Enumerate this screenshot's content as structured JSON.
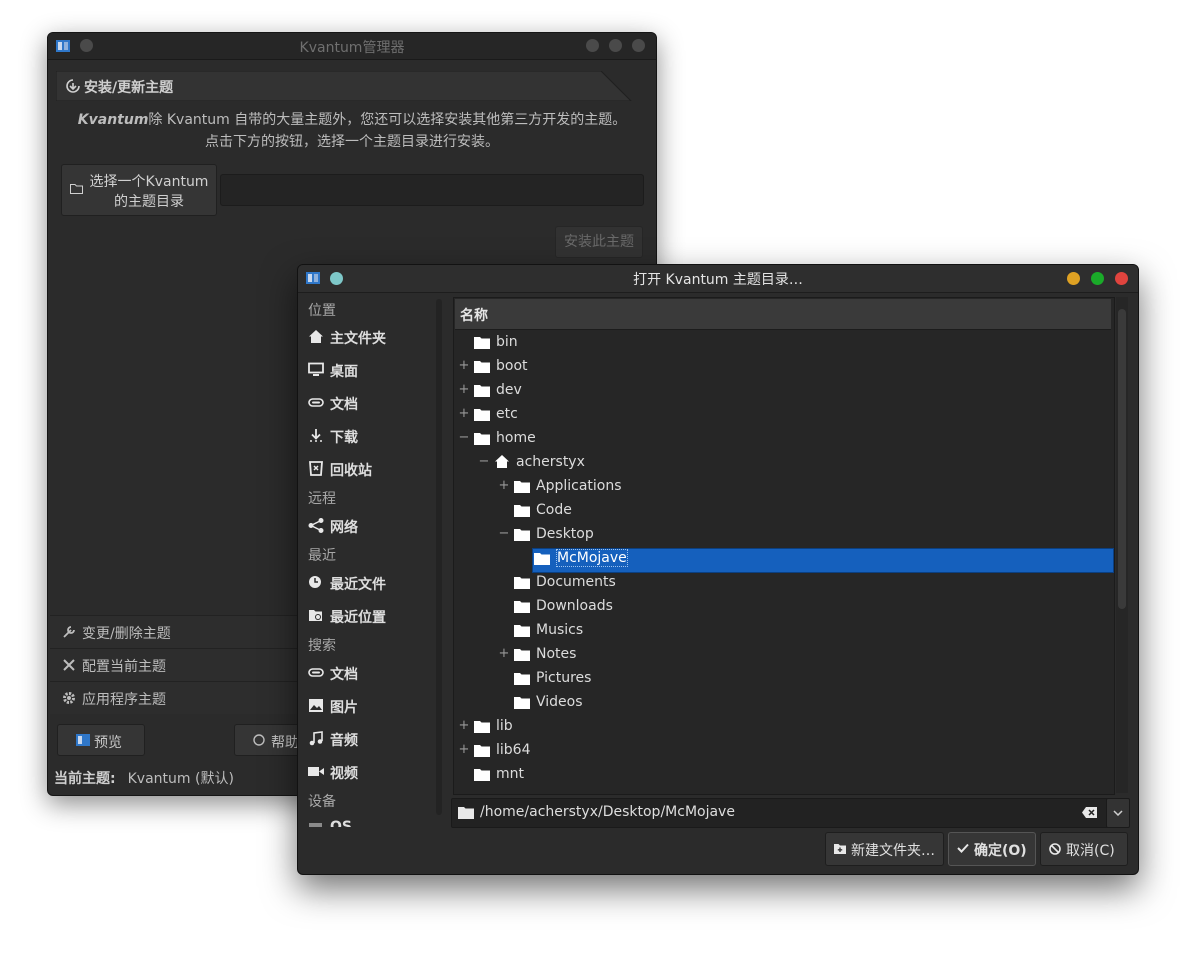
{
  "manager": {
    "title": "Kvantum管理器",
    "tab_label": "安装/更新主题",
    "description_brand": "Kvantum",
    "description_line1": "除 Kvantum 自带的大量主题外，您还可以选择安装其他第三方开发的主题。",
    "description_line2": "点击下方的按钮，选择一个主题目录进行安装。",
    "select_button_line1": "选择一个Kvantum",
    "select_button_line2": "的主题目录",
    "install_button": "安装此主题",
    "sections": [
      "变更/删除主题",
      "配置当前主题",
      "应用程序主题"
    ],
    "preview_button": "预览",
    "help_button": "帮助",
    "status_label": "当前主题:",
    "status_value": "Kvantum (默认)"
  },
  "dialog": {
    "title": "打开 Kvantum 主题目录…",
    "sidebar": {
      "places_header": "位置",
      "places": [
        {
          "label": "主文件夹",
          "icon": "home-icon"
        },
        {
          "label": "桌面",
          "icon": "desktop-icon"
        },
        {
          "label": "文档",
          "icon": "documents-icon"
        },
        {
          "label": "下载",
          "icon": "download-icon"
        },
        {
          "label": "回收站",
          "icon": "trash-icon"
        }
      ],
      "remote_header": "远程",
      "remote": [
        {
          "label": "网络",
          "icon": "network-icon"
        }
      ],
      "recent_header": "最近",
      "recent": [
        {
          "label": "最近文件",
          "icon": "recent-files-icon"
        },
        {
          "label": "最近位置",
          "icon": "recent-locations-icon"
        }
      ],
      "search_header": "搜索",
      "search": [
        {
          "label": "文档",
          "icon": "documents-icon"
        },
        {
          "label": "图片",
          "icon": "pictures-icon"
        },
        {
          "label": "音频",
          "icon": "audio-icon"
        },
        {
          "label": "视频",
          "icon": "video-icon"
        }
      ],
      "devices_header": "设备",
      "devices": [
        {
          "label": "OS",
          "icon": "drive-icon"
        }
      ]
    },
    "column_header": "名称",
    "tree": [
      {
        "label": "bin",
        "level": 0,
        "expander": ""
      },
      {
        "label": "boot",
        "level": 0,
        "expander": "+"
      },
      {
        "label": "dev",
        "level": 0,
        "expander": "+"
      },
      {
        "label": "etc",
        "level": 0,
        "expander": "+"
      },
      {
        "label": "home",
        "level": 0,
        "expander": "−"
      },
      {
        "label": "acherstyx",
        "level": 1,
        "expander": "−",
        "icon": "home-icon"
      },
      {
        "label": "Applications",
        "level": 2,
        "expander": "+"
      },
      {
        "label": "Code",
        "level": 2,
        "expander": ""
      },
      {
        "label": "Desktop",
        "level": 2,
        "expander": "−"
      },
      {
        "label": "McMojave",
        "level": 3,
        "expander": "",
        "selected": true
      },
      {
        "label": "Documents",
        "level": 2,
        "expander": ""
      },
      {
        "label": "Downloads",
        "level": 2,
        "expander": ""
      },
      {
        "label": "Musics",
        "level": 2,
        "expander": ""
      },
      {
        "label": "Notes",
        "level": 2,
        "expander": "+"
      },
      {
        "label": "Pictures",
        "level": 2,
        "expander": ""
      },
      {
        "label": "Videos",
        "level": 2,
        "expander": ""
      },
      {
        "label": "lib",
        "level": 0,
        "expander": "+"
      },
      {
        "label": "lib64",
        "level": 0,
        "expander": "+"
      },
      {
        "label": "mnt",
        "level": 0,
        "expander": ""
      }
    ],
    "path_value": "/home/acherstyx/Desktop/McMojave",
    "new_folder_button": "新建文件夹…",
    "ok_button": "确定(O)",
    "cancel_button": "取消(C)"
  },
  "colors": {
    "selection": "#1560bd",
    "close": "#e0443e",
    "minimize": "#dea123",
    "maximize": "#1aab29"
  }
}
